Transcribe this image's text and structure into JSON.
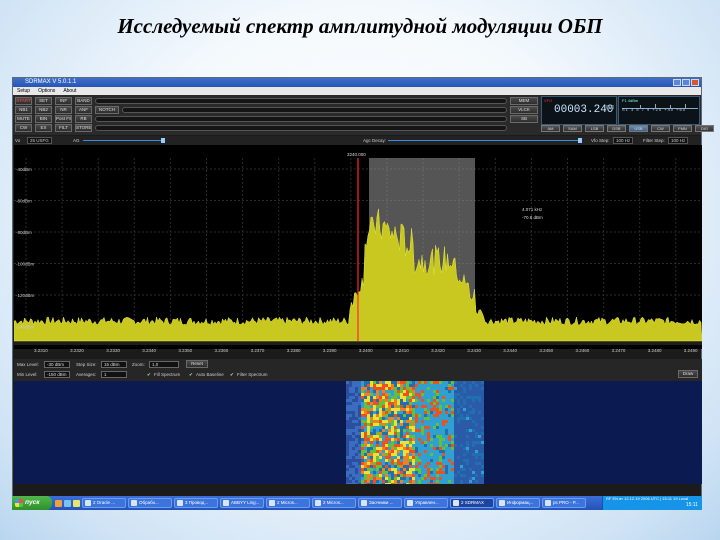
{
  "slide": {
    "title": "Исследуемый спектр амплитудной модуляции ОБП"
  },
  "window": {
    "title": "SDRMAX V 5.0.1.1"
  },
  "menu": [
    "Setup",
    "Options",
    "About"
  ],
  "controls": {
    "row1": [
      "START",
      "SET",
      "INF",
      "BAND"
    ],
    "row2": [
      "NB1",
      "NB2",
      "NR",
      "ANF",
      "NOTCH"
    ],
    "row3": [
      "MUTE",
      "BIN",
      "Post FS",
      "RB"
    ],
    "row4": [
      "CW",
      "EX",
      "FILT",
      "STORE"
    ],
    "right_col": [
      "MEM",
      "VLCK",
      "SB"
    ],
    "freq_label": "VFO",
    "freq_display": "00003.240",
    "freq_fine": "000",
    "meter_label": "F1 4dBm",
    "meter_scale": "S1 3 5 7 9 +20 +40 +60",
    "modes": [
      "AM",
      "SAM",
      "LSB",
      "DSB",
      "USB",
      "CW",
      "FMN",
      "DIG"
    ],
    "active_mode": "USB"
  },
  "sliders": {
    "vol_label": "Vo",
    "vol_value": "25 USFG",
    "agc_label": "AG",
    "agc_decay_label": "Agc Decay:",
    "vfo_step_label": "Vfo Step:",
    "vfo_step_value": "100 Hz",
    "filter_step_label": "Filter Step:",
    "filter_step_value": "100 Hz"
  },
  "spectrum": {
    "center_marker": "3240.000",
    "readout_freq": "4.071 kHz",
    "readout_level": "-70.8 dBm",
    "ylabels": [
      "-40dBm",
      "-60dBm",
      "-80dBm",
      "-100dBm",
      "-120dBm",
      "-140dBm"
    ],
    "xlabels": [
      "3.2310",
      "3.2320",
      "3.2330",
      "3.2340",
      "3.2350",
      "3.2360",
      "3.2370",
      "3.2380",
      "3.2390",
      "3.2400",
      "3.2410",
      "3.2420",
      "3.2430",
      "3.2440",
      "3.2450",
      "3.2460",
      "3.2470",
      "3.2480",
      "3.2490"
    ]
  },
  "bottom": {
    "max_level_label": "Max Level:",
    "max_level": "-30 dBm",
    "step_size_label": "Step Size:",
    "step_size": "15 dBm",
    "zoom_label": "Zoom:",
    "zoom": "1,0",
    "reset": "Reset",
    "min_level_label": "Min Level:",
    "min_level": "-150 dBm",
    "averages_label": "Averages:",
    "averages": "1",
    "fill_spectrum": "Fill Spectrum",
    "auto_baseline": "Auto Baseline",
    "filter_spectrum": "Filter Spectrum",
    "draw": "Draw"
  },
  "taskbar": {
    "start": "пуск",
    "tasks": [
      "2 Oracle ...",
      "Обрабо...",
      "3 Провод...",
      "ABBYY Ling...",
      "2 Micros...",
      "2 Micros...",
      "Заочники ...",
      "Управлен...",
      "2 SDRMAX",
      "Информац...",
      "ps PRO - P..."
    ],
    "active_task": 8,
    "tray_line1": "RF EN  вт 12.12.19 2006 UTC | 15:11 19 Local",
    "tray_time": "15:11"
  }
}
